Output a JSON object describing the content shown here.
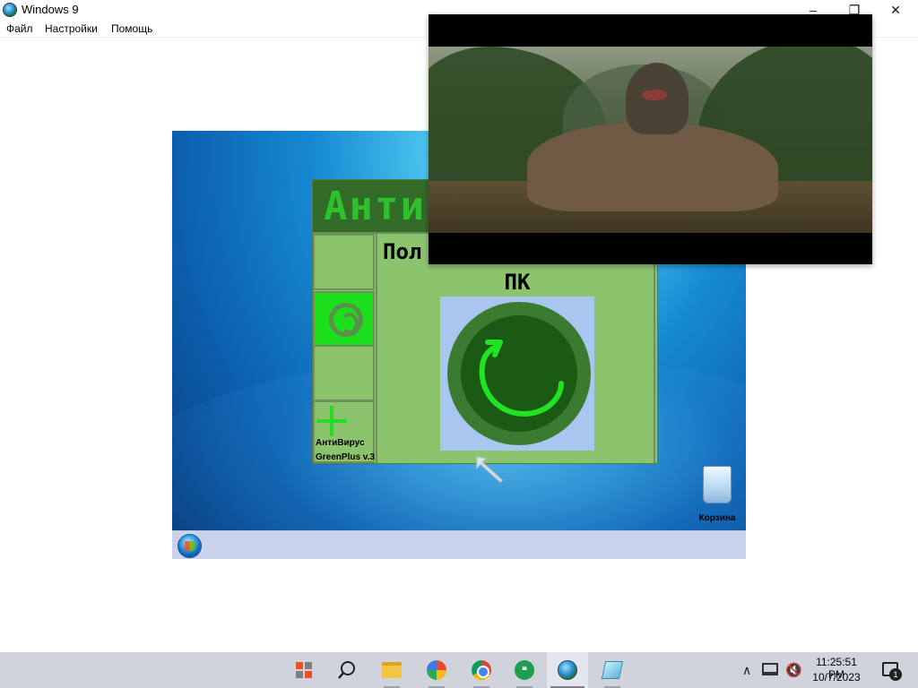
{
  "window": {
    "title": "Windows 9",
    "controls": {
      "minimize": "–",
      "maximize": "❐",
      "close": "✕"
    }
  },
  "menu": {
    "file": "Файл",
    "settings": "Настройки",
    "help": "Помощь"
  },
  "emulator": {
    "recycle_bin_label": "Корзина",
    "antivirus": {
      "header_title": "Анти",
      "status_line1": "Пол",
      "status_line2": "ПК",
      "brand_line1": "АнтиВирус",
      "brand_line2": "GreenPlus v.3",
      "colors": {
        "background": "#8cc46e",
        "header": "#336b29",
        "accent": "#1de01d"
      }
    }
  },
  "taskbar": {
    "apps": [
      "start-icon",
      "search-icon",
      "file-explorer-icon",
      "photos-icon",
      "chrome-icon",
      "hangouts-icon",
      "windows9-vm-icon",
      "notes-icon"
    ],
    "tray": {
      "chevron": "∧",
      "volume": "🔇",
      "time": "11:25:51 PM",
      "date": "10/7/2023",
      "notification_count": "1"
    }
  }
}
